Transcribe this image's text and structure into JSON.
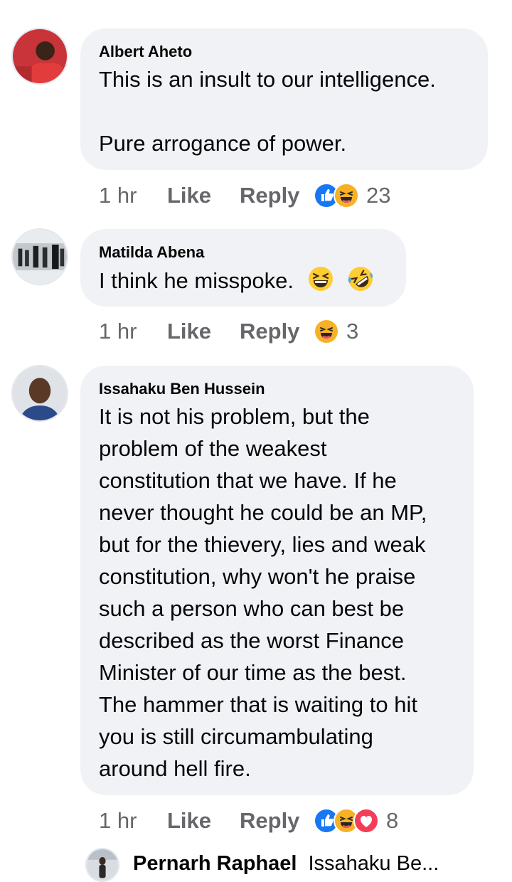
{
  "comments": [
    {
      "author": "Albert Aheto",
      "lines": [
        "This is an insult to our intelligence.",
        "",
        "Pure arrogance of power."
      ],
      "time": "1 hr",
      "like_label": "Like",
      "reply_label": "Reply",
      "reactions": [
        "like",
        "haha"
      ],
      "reaction_count": "23"
    },
    {
      "author": "Matilda Abena",
      "text": "I think he misspoke.",
      "emojis": [
        "grinning-squinting-face",
        "rolling-on-floor-laughing-face"
      ],
      "time": "1 hr",
      "like_label": "Like",
      "reply_label": "Reply",
      "reactions": [
        "haha"
      ],
      "reaction_count": "3"
    },
    {
      "author": "Issahaku Ben Hussein",
      "lines": [
        "It is not his problem, but the",
        "problem of the weakest",
        "constitution that we have. If he",
        "never thought he could be an MP,",
        "but for the thievery, lies and weak",
        "constitution, why won't he praise",
        "such a person who can best be",
        "described as the worst Finance",
        "Minister of our time as the best.",
        "The hammer that is waiting to hit",
        "you is still circumambulating",
        "around hell fire."
      ],
      "time": "1 hr",
      "like_label": "Like",
      "reply_label": "Reply",
      "reactions": [
        "like",
        "haha",
        "love"
      ],
      "reaction_count": "8"
    }
  ],
  "reply_preview": {
    "author": "Pernarh Raphael",
    "text": "Issahaku Be..."
  },
  "colors": {
    "bubble": "#f0f2f5",
    "meta_text": "#65676b",
    "like_blue": "#1877f2",
    "love_red": "#f33e58",
    "haha_yellow": "#f7b125"
  }
}
